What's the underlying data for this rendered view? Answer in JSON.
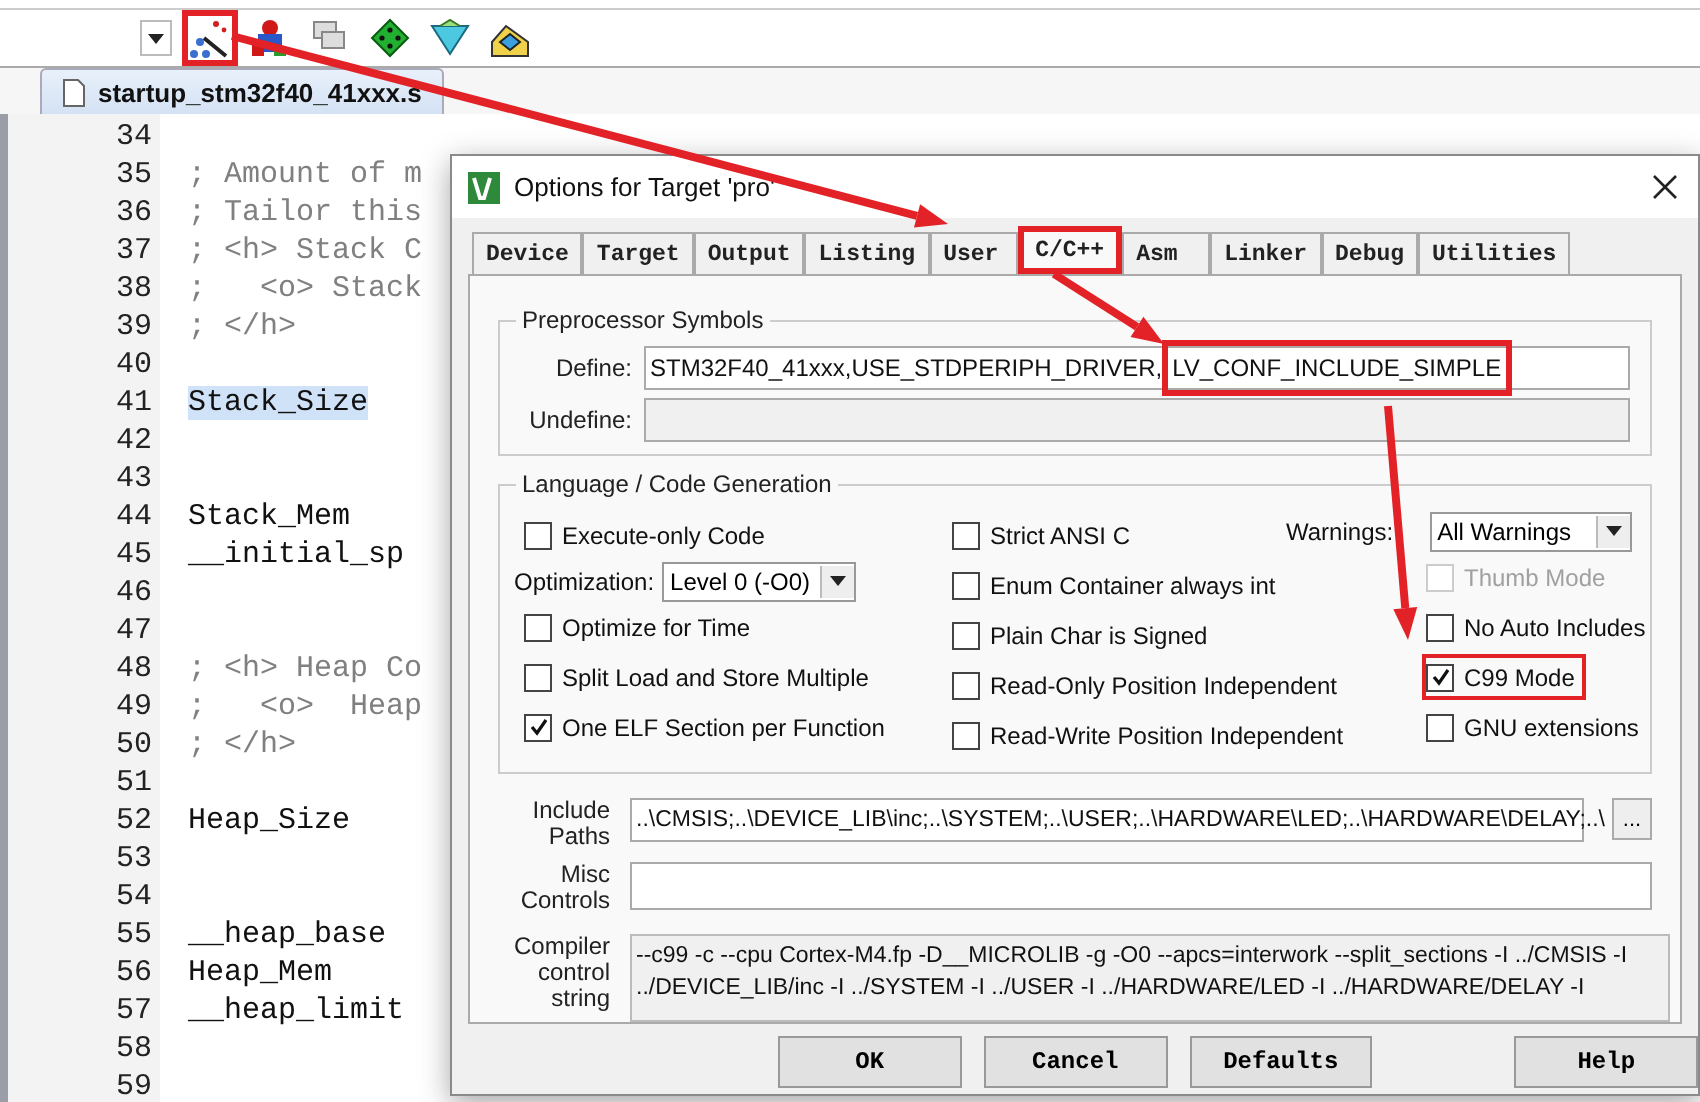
{
  "toolbar": [
    {
      "kind": "wand",
      "highlighted": true
    },
    {
      "kind": "components",
      "highlighted": false
    },
    {
      "kind": "windows",
      "highlighted": false
    },
    {
      "kind": "diamond",
      "highlighted": false
    },
    {
      "kind": "funnel",
      "highlighted": false
    },
    {
      "kind": "packs",
      "highlighted": false
    }
  ],
  "file_tab": {
    "label": "startup_stm32f40_41xxx.s",
    "selected": true
  },
  "editor": {
    "lines": [
      {
        "number": "34"
      },
      {
        "number": "35",
        "text": "; Amount of m",
        "kind": "comment"
      },
      {
        "number": "36",
        "text": "; Tailor this",
        "kind": "comment"
      },
      {
        "number": "37",
        "text": "; <h> Stack C",
        "kind": "comment"
      },
      {
        "number": "38",
        "text": ";   <o> Stack",
        "kind": "comment"
      },
      {
        "number": "39",
        "text": "; </h>",
        "kind": "comment"
      },
      {
        "number": "40"
      },
      {
        "number": "41",
        "text": "Stack_Size",
        "kind": "code",
        "highlighted": true
      },
      {
        "number": "42"
      },
      {
        "number": "43"
      },
      {
        "number": "44",
        "text": "Stack_Mem",
        "kind": "code"
      },
      {
        "number": "45",
        "text": "__initial_sp",
        "kind": "code"
      },
      {
        "number": "46"
      },
      {
        "number": "47"
      },
      {
        "number": "48",
        "text": "; <h> Heap Co",
        "kind": "comment"
      },
      {
        "number": "49",
        "text": ";   <o>  Heap",
        "kind": "comment"
      },
      {
        "number": "50",
        "text": "; </h>",
        "kind": "comment"
      },
      {
        "number": "51"
      },
      {
        "number": "52",
        "text": "Heap_Size",
        "kind": "code"
      },
      {
        "number": "53"
      },
      {
        "number": "54"
      },
      {
        "number": "55",
        "text": "__heap_base",
        "kind": "code"
      },
      {
        "number": "56",
        "text": "Heap_Mem",
        "kind": "code"
      },
      {
        "number": "57",
        "text": "__heap_limit",
        "kind": "code"
      },
      {
        "number": "58"
      },
      {
        "number": "59"
      }
    ]
  },
  "dialog": {
    "title": "Options for Target 'pro'",
    "tabs": [
      {
        "label": "Device",
        "selected": false,
        "highlighted": false
      },
      {
        "label": "Target",
        "selected": false,
        "highlighted": false
      },
      {
        "label": "Output",
        "selected": false,
        "highlighted": false
      },
      {
        "label": "Listing",
        "selected": false,
        "highlighted": false
      },
      {
        "label": "User",
        "selected": false,
        "highlighted": false
      },
      {
        "label": "C/C++",
        "selected": true,
        "highlighted": true
      },
      {
        "label": "Asm",
        "selected": false,
        "highlighted": false
      },
      {
        "label": "Linker",
        "selected": false,
        "highlighted": false
      },
      {
        "label": "Debug",
        "selected": false,
        "highlighted": false
      },
      {
        "label": "Utilities",
        "selected": false,
        "highlighted": false
      }
    ],
    "preprocessor": {
      "title": "Preprocessor Symbols",
      "define": {
        "label": "Define:",
        "parts": [
          {
            "text": "STM32F40_41xxx,USE_STDPERIPH_DRIVER,",
            "highlighted": false
          },
          {
            "text": "LV_CONF_INCLUDE_SIMPLE",
            "highlighted": true
          }
        ]
      },
      "undefine": {
        "label": "Undefine:",
        "disabled": true
      }
    },
    "language": {
      "title": "Language / Code Generation",
      "columns": [
        [
          {
            "kind": "checkbox",
            "label": "Execute-only Code",
            "checked": false,
            "disabled": false,
            "highlighted": false
          },
          {
            "kind": "select",
            "label": "Optimization:",
            "value": "Level 0 (-O0)"
          },
          {
            "kind": "checkbox",
            "label": "Optimize for Time",
            "checked": false,
            "disabled": false,
            "highlighted": false
          },
          {
            "kind": "checkbox",
            "label": "Split Load and Store Multiple",
            "checked": false,
            "disabled": false,
            "highlighted": false
          },
          {
            "kind": "checkbox",
            "label": "One ELF Section per Function",
            "checked": true,
            "disabled": false,
            "highlighted": false
          }
        ],
        [
          {
            "kind": "checkbox",
            "label": "Strict ANSI C",
            "checked": false,
            "disabled": false,
            "highlighted": false
          },
          {
            "kind": "checkbox",
            "label": "Enum Container always int",
            "checked": false,
            "disabled": false,
            "highlighted": false
          },
          {
            "kind": "checkbox",
            "label": "Plain Char is Signed",
            "checked": false,
            "disabled": false,
            "highlighted": false
          },
          {
            "kind": "checkbox",
            "label": "Read-Only Position Independent",
            "checked": false,
            "disabled": false,
            "highlighted": false
          },
          {
            "kind": "checkbox",
            "label": "Read-Write Position Independent",
            "checked": false,
            "disabled": false,
            "highlighted": false
          }
        ],
        [
          {
            "kind": "select",
            "label": "Warnings:",
            "value": "All Warnings"
          },
          {
            "kind": "checkbox",
            "label": "Thumb Mode",
            "checked": false,
            "disabled": true,
            "highlighted": false
          },
          {
            "kind": "checkbox",
            "label": "No Auto Includes",
            "checked": false,
            "disabled": false,
            "highlighted": false
          },
          {
            "kind": "checkbox",
            "label": "C99 Mode",
            "checked": true,
            "disabled": false,
            "highlighted": true
          },
          {
            "kind": "checkbox",
            "label": "GNU extensions",
            "checked": false,
            "disabled": false,
            "highlighted": false
          }
        ]
      ]
    },
    "include_paths": {
      "label": "Include Paths",
      "value": "..\\CMSIS;..\\DEVICE_LIB\\inc;..\\SYSTEM;..\\USER;..\\HARDWARE\\LED;..\\HARDWARE\\DELAY;..\\",
      "browse": "..."
    },
    "misc_controls": {
      "label": "Misc Controls"
    },
    "compiler_string": {
      "label": "Compiler control string",
      "lines": [
        "--c99 -c --cpu Cortex-M4.fp -D__MICROLIB -g -O0 --apcs=interwork --split_sections -I ../CMSIS -I",
        "../DEVICE_LIB/inc -I ../SYSTEM -I ../USER -I ../HARDWARE/LED -I ../HARDWARE/DELAY -I"
      ]
    },
    "buttons": [
      "OK",
      "Cancel",
      "Defaults",
      "Help"
    ]
  }
}
